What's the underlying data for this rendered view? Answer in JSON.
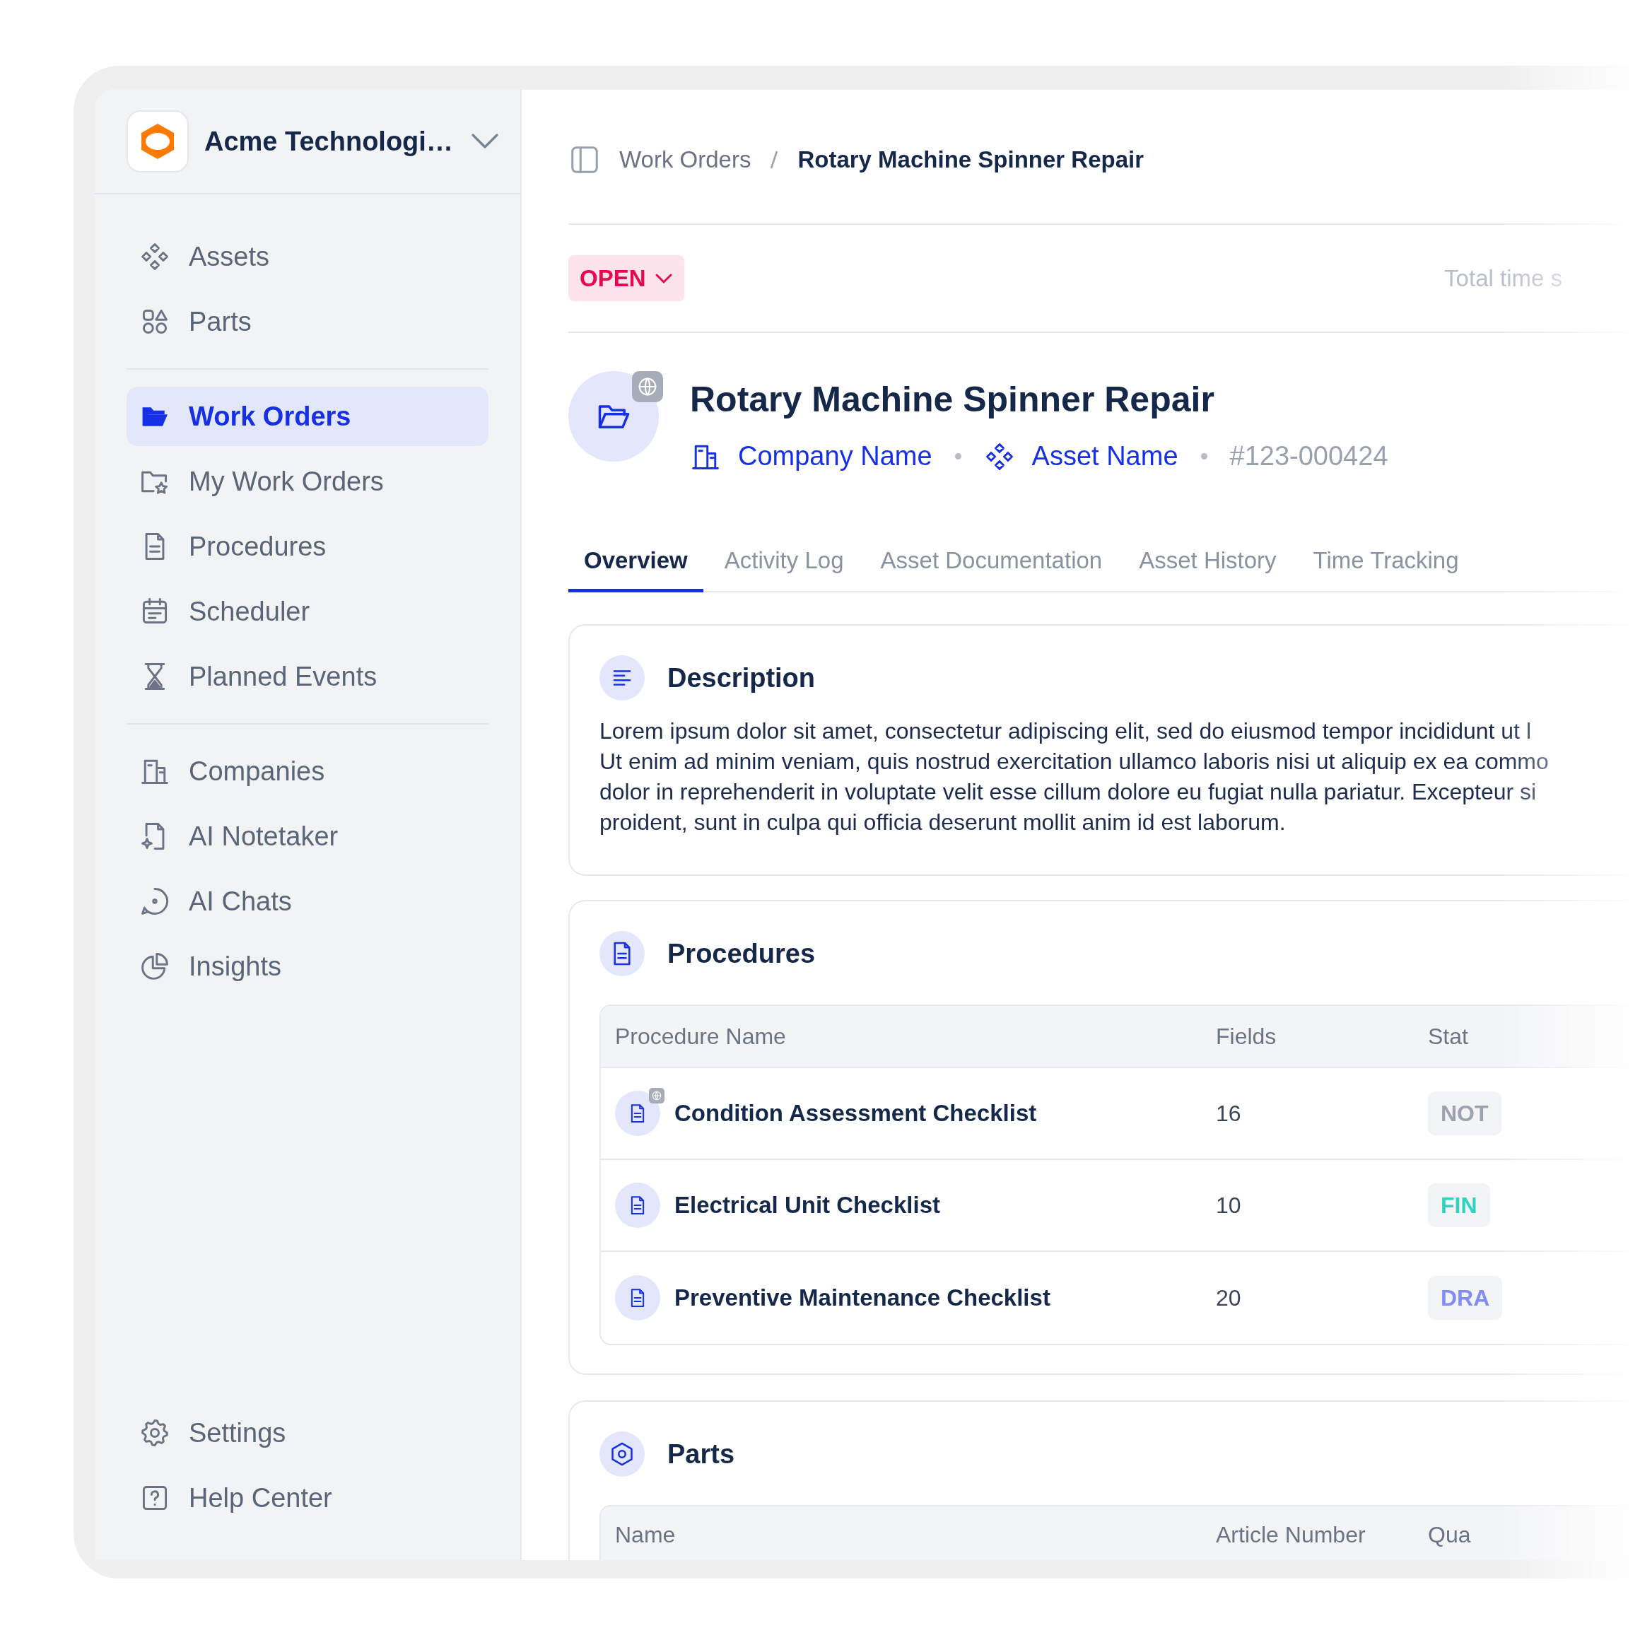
{
  "workspace": {
    "name": "Acme Technologi…"
  },
  "sidebar": {
    "groups": [
      [
        {
          "label": "Assets",
          "selected": false
        },
        {
          "label": "Parts",
          "selected": false
        }
      ],
      [
        {
          "label": "Work Orders",
          "selected": true
        },
        {
          "label": "My Work Orders",
          "selected": false
        },
        {
          "label": "Procedures",
          "selected": false
        },
        {
          "label": "Scheduler",
          "selected": false
        },
        {
          "label": "Planned Events",
          "selected": false
        }
      ],
      [
        {
          "label": "Companies",
          "selected": false
        },
        {
          "label": "AI Notetaker",
          "selected": false
        },
        {
          "label": "AI Chats",
          "selected": false
        },
        {
          "label": "Insights",
          "selected": false
        }
      ]
    ],
    "footer": [
      {
        "label": "Settings",
        "selected": false
      },
      {
        "label": "Help Center",
        "selected": false
      }
    ]
  },
  "breadcrumb": [
    "Work Orders",
    "Rotary Machine Spinner Repair"
  ],
  "status": {
    "label": "OPEN"
  },
  "total_time": "Total time s",
  "work_order": {
    "title": "Rotary Machine Spinner Repair",
    "company": "Company Name",
    "asset": "Asset Name",
    "number": "#123-000424",
    "shared": true
  },
  "tabs": [
    {
      "label": "Overview",
      "selected": true
    },
    {
      "label": "Activity Log",
      "selected": false
    },
    {
      "label": "Asset Documentation",
      "selected": false
    },
    {
      "label": "Asset History",
      "selected": false
    },
    {
      "label": "Time Tracking",
      "selected": false
    }
  ],
  "description": {
    "title": "Description",
    "lines": [
      "Lorem ipsum dolor sit amet, consectetur adipiscing elit, sed do eiusmod tempor incididunt ut l",
      "Ut enim ad minim veniam, quis nostrud exercitation ullamco laboris nisi ut aliquip ex ea commo",
      "dolor in reprehenderit in voluptate velit esse cillum dolore eu fugiat nulla pariatur. Excepteur si",
      "proident, sunt in culpa qui officia deserunt mollit anim id est laborum."
    ]
  },
  "procedures": {
    "title": "Procedures",
    "columns": [
      "Procedure Name",
      "Fields",
      "Stat"
    ],
    "rows": [
      {
        "name": "Condition Assessment Checklist",
        "fields": "16",
        "shared": true,
        "status": {
          "label": "NOT",
          "color": "#9ca3af"
        }
      },
      {
        "name": "Electrical Unit Checklist",
        "fields": "10",
        "shared": false,
        "status": {
          "label": "FIN",
          "color": "#2dd4bf"
        }
      },
      {
        "name": "Preventive Maintenance Checklist",
        "fields": "20",
        "shared": false,
        "status": {
          "label": "DRA",
          "color": "#818cf8"
        }
      }
    ]
  },
  "parts": {
    "title": "Parts",
    "columns": [
      "Name",
      "Article Number",
      "Qua"
    ]
  }
}
